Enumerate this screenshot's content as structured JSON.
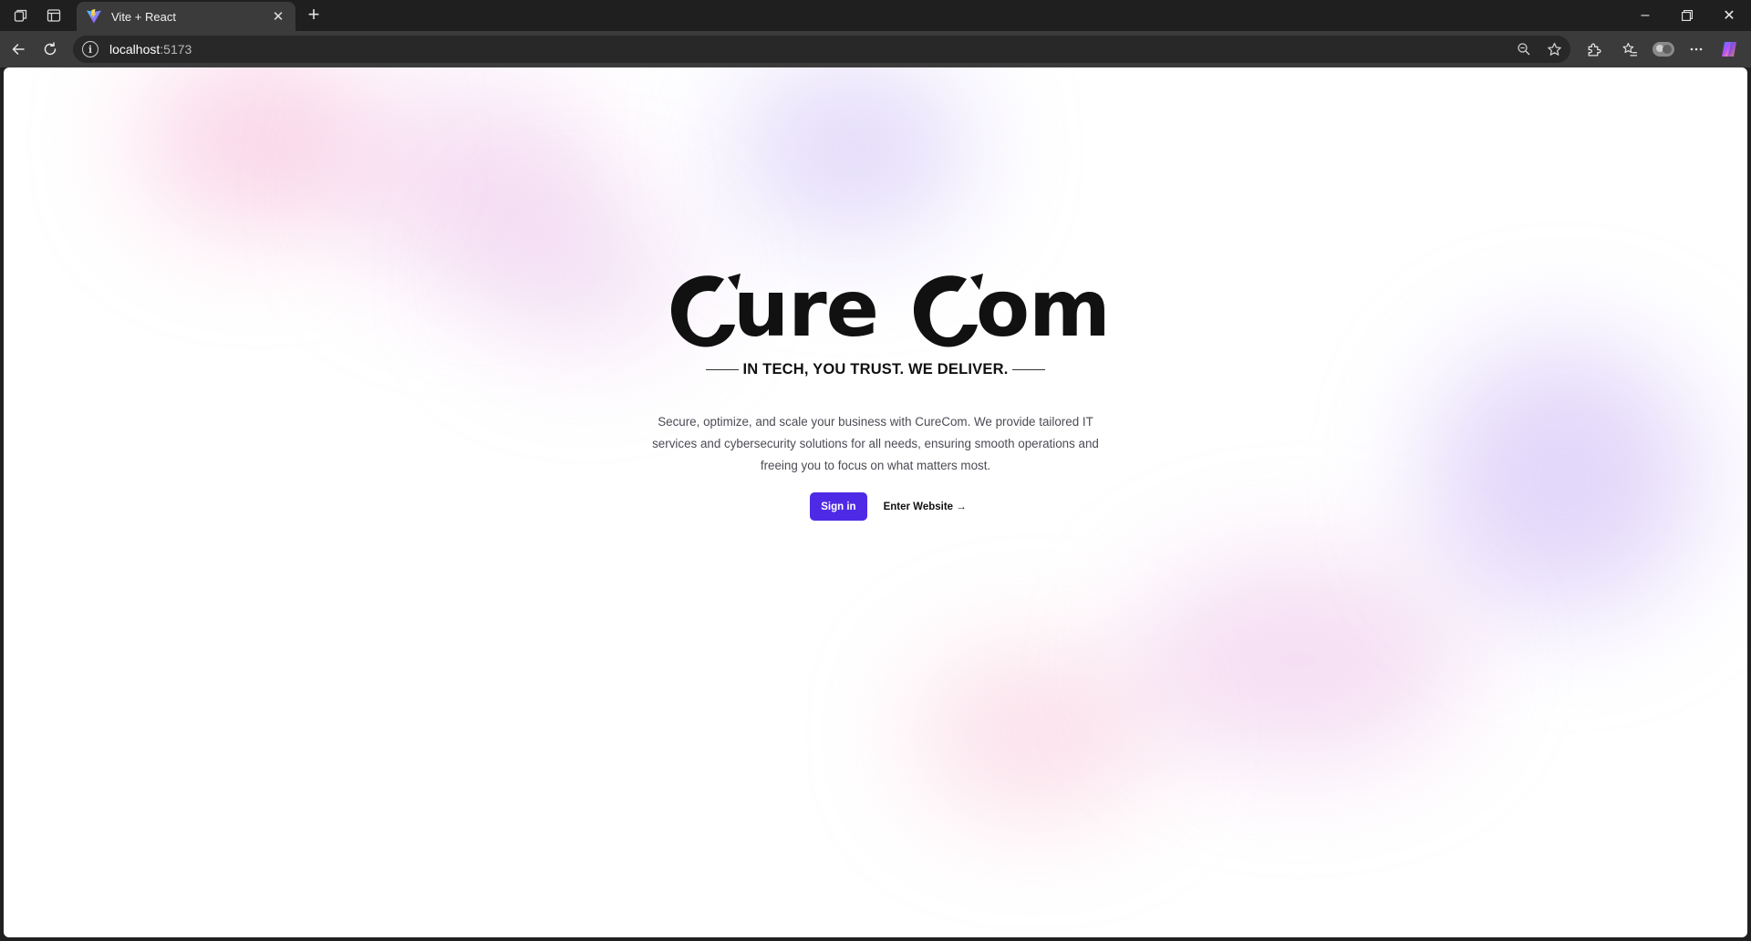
{
  "browser": {
    "tab": {
      "title": "Vite + React",
      "close_label": "✕"
    },
    "new_tab_label": "+",
    "address": {
      "host": "localhost",
      "port": ":5173"
    },
    "window_controls": {
      "minimize": "–",
      "restore": "❐",
      "close": "✕"
    }
  },
  "page": {
    "logo": {
      "c1": "C",
      "part1": "ure",
      "c2": "C",
      "part2": "om"
    },
    "tagline": "IN TECH, YOU TRUST. WE DELIVER.",
    "description": "Secure, optimize, and scale your business with CureCom. We provide tailored IT services and cybersecurity solutions for all needs, ensuring smooth operations and freeing you to focus on what matters most.",
    "primary_cta": "Sign in",
    "secondary_cta": "Enter Website →"
  },
  "colors": {
    "accent": "#4f2ae6",
    "chrome_dark": "#1f1f1f",
    "chrome_mid": "#3b3b3b"
  }
}
